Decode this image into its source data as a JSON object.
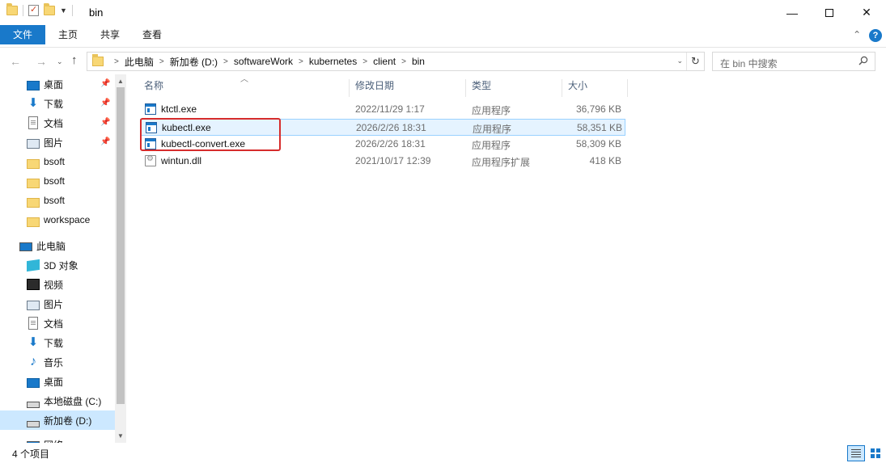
{
  "window": {
    "title": "bin",
    "minimize_glyph": "—",
    "close_glyph": "✕"
  },
  "ribbon": {
    "tabs": [
      "文件",
      "主页",
      "共享",
      "查看"
    ]
  },
  "address": {
    "crumbs": [
      "此电脑",
      "新加卷 (D:)",
      "softwareWork",
      "kubernetes",
      "client",
      "bin"
    ],
    "separator": ">",
    "refresh_glyph": "↻"
  },
  "search": {
    "placeholder": "在 bin 中搜索"
  },
  "sidebar": {
    "quick_access": [
      {
        "label": "桌面",
        "icon": "desktop-icon",
        "pinned": true
      },
      {
        "label": "下载",
        "icon": "download-icon",
        "pinned": true
      },
      {
        "label": "文档",
        "icon": "document-icon",
        "pinned": true
      },
      {
        "label": "图片",
        "icon": "picture-icon",
        "pinned": true
      },
      {
        "label": "bsoft",
        "icon": "folder-icon",
        "pinned": false
      },
      {
        "label": "bsoft",
        "icon": "folder-icon",
        "pinned": false
      },
      {
        "label": "bsoft",
        "icon": "folder-icon",
        "pinned": false
      },
      {
        "label": "workspace",
        "icon": "folder-icon",
        "pinned": false
      }
    ],
    "this_pc": {
      "label": "此电脑",
      "icon": "computer-icon"
    },
    "pc_items": [
      {
        "label": "3D 对象",
        "icon": "3d-objects-icon"
      },
      {
        "label": "视频",
        "icon": "video-icon"
      },
      {
        "label": "图片",
        "icon": "picture-icon"
      },
      {
        "label": "文档",
        "icon": "document-icon"
      },
      {
        "label": "下载",
        "icon": "download-icon"
      },
      {
        "label": "音乐",
        "icon": "music-icon"
      },
      {
        "label": "桌面",
        "icon": "desktop-icon"
      },
      {
        "label": "本地磁盘 (C:)",
        "icon": "drive-icon"
      },
      {
        "label": "新加卷 (D:)",
        "icon": "drive-icon",
        "selected": true
      },
      {
        "label": "网络",
        "icon": "network-icon"
      }
    ]
  },
  "columns": {
    "name": "名称",
    "date": "修改日期",
    "type": "类型",
    "size": "大小"
  },
  "files": [
    {
      "name": "ktctl.exe",
      "date": "2022/11/29 1:17",
      "type": "应用程序",
      "size": "36,796 KB",
      "icon": "exe-icon"
    },
    {
      "name": "kubectl.exe",
      "date": "2026/2/26 18:31",
      "type": "应用程序",
      "size": "58,351 KB",
      "icon": "exe-icon"
    },
    {
      "name": "kubectl-convert.exe",
      "date": "2026/2/26 18:31",
      "type": "应用程序",
      "size": "58,309 KB",
      "icon": "exe-icon"
    },
    {
      "name": "wintun.dll",
      "date": "2021/10/17 12:39",
      "type": "应用程序扩展",
      "size": "418 KB",
      "icon": "dll-icon"
    }
  ],
  "status": {
    "count": "4 个项目"
  },
  "colors": {
    "accent": "#1979ca",
    "selected_bg": "#cce8ff",
    "highlight_box": "#d62c2c"
  }
}
